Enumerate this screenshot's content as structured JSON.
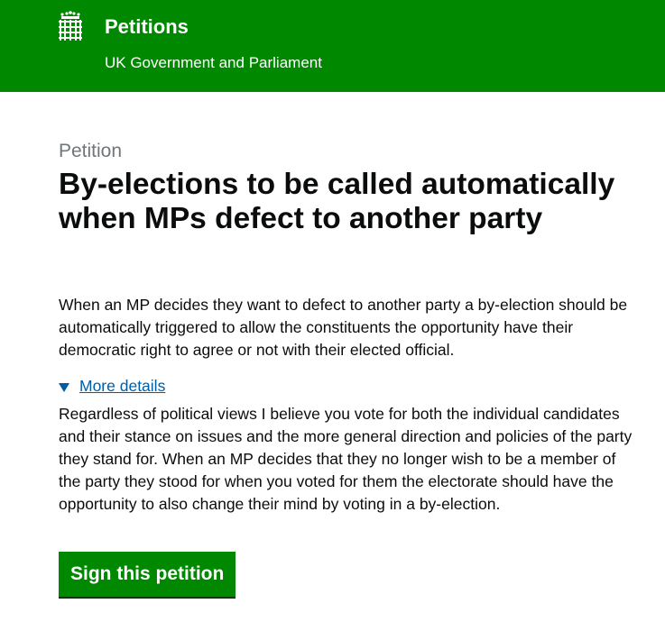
{
  "header": {
    "title": "Petitions",
    "subtitle": "UK Government and Parliament",
    "logo_icon": "crowned-portcullis-icon",
    "background_color": "#008800"
  },
  "petition": {
    "caption": "Petition",
    "title": "By-elections to be called automatically when MPs defect to another party",
    "summary": "When an MP decides they want to defect to another party a by-election should be automatically triggered to allow the constituents the opportunity have their democratic right to agree or not with their elected official.",
    "details_toggle_label": "More details",
    "details_expanded": true,
    "details_text": "Regardless of political views I believe you vote for both the individual candidates and their stance on issues and the more general direction and policies of the party they stand for. When an MP decides that they no longer wish to be a member of the party they stood for when you voted for them the electorate should have the opportunity to also change their mind by voting in a by-election.",
    "sign_button_label": "Sign this petition"
  },
  "colors": {
    "brand_green": "#008800",
    "link_blue": "#005ea5",
    "caption_grey": "#6f777b",
    "text": "#0b0c0c"
  }
}
